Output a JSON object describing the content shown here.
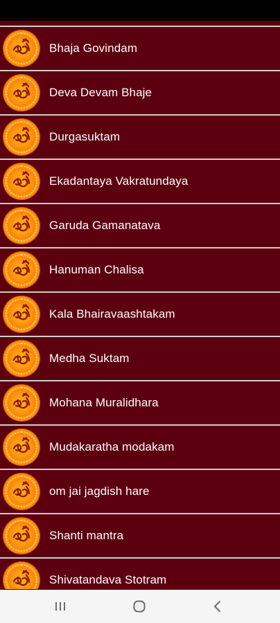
{
  "list": {
    "items": [
      {
        "label": "Bhaja Govindam",
        "icon": "om-icon"
      },
      {
        "label": "Deva Devam Bhaje",
        "icon": "om-icon"
      },
      {
        "label": "Durgasuktam",
        "icon": "om-icon"
      },
      {
        "label": "Ekadantaya Vakratundaya",
        "icon": "om-icon"
      },
      {
        "label": "Garuda Gamanatava",
        "icon": "om-icon"
      },
      {
        "label": "Hanuman Chalisa",
        "icon": "om-icon"
      },
      {
        "label": "Kala Bhairavaashtakam",
        "icon": "om-icon"
      },
      {
        "label": "Medha Suktam",
        "icon": "om-icon"
      },
      {
        "label": "Mohana Muralidhara",
        "icon": "om-icon"
      },
      {
        "label": "Mudakaratha modakam",
        "icon": "om-icon"
      },
      {
        "label": "om jai jagdish hare",
        "icon": "om-icon"
      },
      {
        "label": "Shanti mantra",
        "icon": "om-icon"
      },
      {
        "label": "Shivatandava Stotram",
        "icon": "om-icon"
      }
    ]
  },
  "nav_bar": {
    "recents_icon": "recents-icon",
    "home_icon": "home-icon",
    "back_icon": "back-icon"
  },
  "colors": {
    "list_background": "#5c0010",
    "divider": "#cfcfcf",
    "status_bar": "#000000",
    "nav_bar": "#f5f5f5",
    "icon_orange": "#f88608",
    "om_glyph": "#8a1a00"
  }
}
